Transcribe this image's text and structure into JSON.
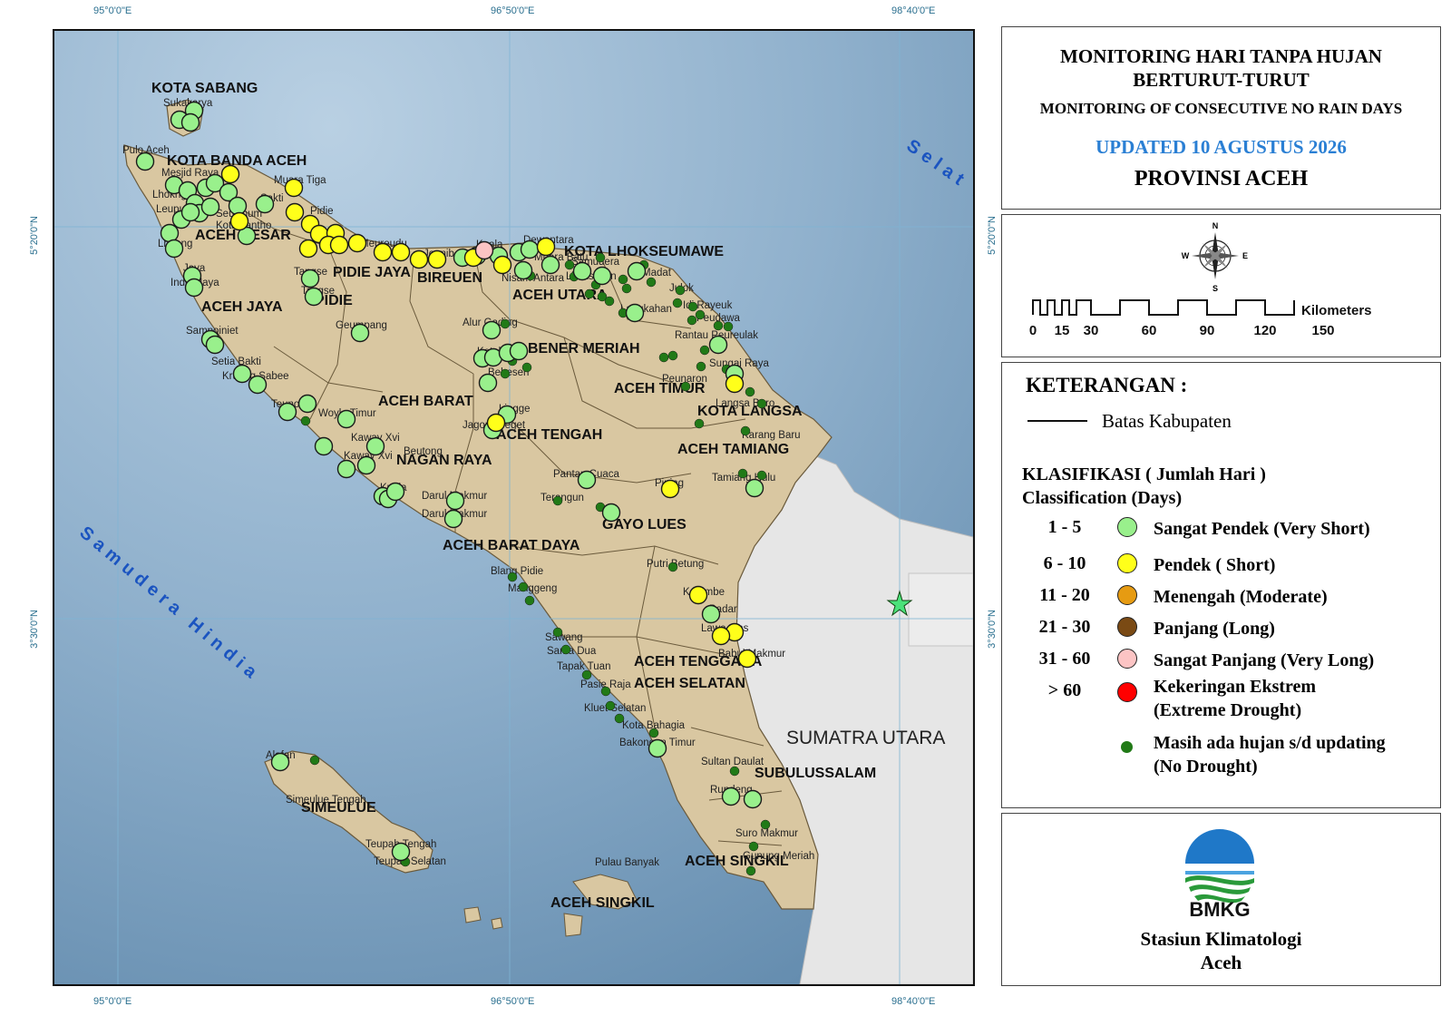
{
  "coords": {
    "lon_left": "95°0'0\"E",
    "lon_mid": "96°50'0\"E",
    "lon_right": "98°40'0\"E",
    "lat_top": "5°20'0\"N",
    "lat_bottom": "3°30'0\"N"
  },
  "map": {
    "sea_labels": [
      "Selat Malaka",
      "Samudera Hindia"
    ],
    "neighbor_label": "SUMATRA UTARA",
    "regions": [
      "KOTA SABANG",
      "KOTA BANDA ACEH",
      "ACEH BESAR",
      "PIDIE JAYA",
      "PIDIE",
      "BIREUEN",
      "KOTA LHOKSEUMAWE",
      "ACEH UTARA",
      "ACEH JAYA",
      "BENER MERIAH",
      "ACEH TIMUR",
      "ACEH BARAT",
      "KOTA LANGSA",
      "ACEH TENGAH",
      "ACEH TAMIANG",
      "NAGAN RAYA",
      "GAYO LUES",
      "ACEH BARAT DAYA",
      "ACEH TENGGARA",
      "ACEH SELATAN",
      "SUBULUSSALAM",
      "SIMEULUE",
      "ACEH SINGKIL",
      "ACEH SINGKIL"
    ],
    "places": [
      "Sukakarya",
      "Pulo Aceh",
      "Mesjid Raya",
      "Lhoknga",
      "Leupung",
      "Lhoong",
      "Jaya",
      "Indra Jaya",
      "Sampoiniet",
      "Setia Bakti",
      "Krueng Sabee",
      "Teunom",
      "Woyla Timur",
      "Kaway Xvi",
      "Kaway Xvi",
      "Beutong",
      "Kuala",
      "Darul Makmur",
      "Darul Makmur",
      "Muara Tiga",
      "Sakti",
      "Mila",
      "Pidie",
      "Seulimum",
      "Kota Jantho",
      "Tangse",
      "Tangse",
      "Meureudu",
      "Jeunib",
      "Geumpang",
      "Kuala",
      "Dewantara",
      "Muara Batu",
      "Samudera",
      "Nisam Antara",
      "Lhoksukon",
      "Madat",
      "Julok",
      "Idi Rayeuk",
      "Peudawa",
      "Rantau Peureulak",
      "Langkahan",
      "Alur Gading",
      "Ketol",
      "Bukit",
      "Bebesen",
      "Lingge",
      "Jagong Jeget",
      "Peunaron",
      "Sungai Raya",
      "Langsa Baro",
      "Karang Baru",
      "Tamiang Hulu",
      "Pining",
      "Pantan Cuaca",
      "Terangun",
      "Blang Pidie",
      "Manggeng",
      "Putri Betung",
      "Ketambe",
      "Badar",
      "Lawe Alas",
      "Babul Makmur",
      "Sawang",
      "Sama Dua",
      "Tapak Tuan",
      "Pasie Raja",
      "Kluet Selatan",
      "Kota Bahagia",
      "Bakongan Timur",
      "Sultan Daulat",
      "Rundeng",
      "Suro Makmur",
      "Gunung Meriah",
      "Pulau Banyak",
      "Alafan",
      "Simeulue Tengah",
      "Teupah Tengah",
      "Teupah Selatan"
    ],
    "station_counts": {
      "very_short": 88,
      "short": 25,
      "very_long": 1,
      "no_drought": 58
    }
  },
  "title_panel": {
    "line1": "MONITORING HARI TANPA HUJAN",
    "line2": "BERTURUT-TURUT",
    "line3": "MONITORING OF CONSECUTIVE NO RAIN DAYS",
    "updated": "UPDATED 10 AGUSTUS 2026",
    "province": "PROVINSI ACEH"
  },
  "compass": {
    "n": "N",
    "s": "S",
    "e": "E",
    "w": "W"
  },
  "scale": {
    "ticks": [
      "0",
      "15",
      "30",
      "60",
      "90",
      "120",
      "150"
    ],
    "unit": "Kilometers"
  },
  "legend": {
    "title": "KETERANGAN :",
    "boundary_label": "Batas Kabupaten",
    "class_title": "KLASIFIKASI ( Jumlah Hari )",
    "class_subtitle": "Classification (Days)",
    "items": [
      {
        "range": "1 - 5",
        "label": "Sangat Pendek (Very Short)",
        "color": "#99f08c"
      },
      {
        "range": "6 - 10",
        "label": "Pendek ( Short)",
        "color": "#ffff1a"
      },
      {
        "range": "11 - 20",
        "label": "Menengah (Moderate)",
        "color": "#e69b12"
      },
      {
        "range": "21 - 30",
        "label": "Panjang (Long)",
        "color": "#7a4a14"
      },
      {
        "range": "31 - 60",
        "label": "Sangat Panjang (Very Long)",
        "color": "#fcc4c4"
      },
      {
        "range": "> 60",
        "label": "Kekeringan Ekstrem",
        "label2": "(Extreme Drought)",
        "color": "#ff0000"
      }
    ],
    "no_drought_label": "Masih ada hujan s/d updating",
    "no_drought_label2": "(No Drought)",
    "no_drought_color": "#217a17"
  },
  "logo_panel": {
    "logo_text": "BMKG",
    "station_line1": "Stasiun Klimatologi",
    "station_line2": "Aceh"
  }
}
